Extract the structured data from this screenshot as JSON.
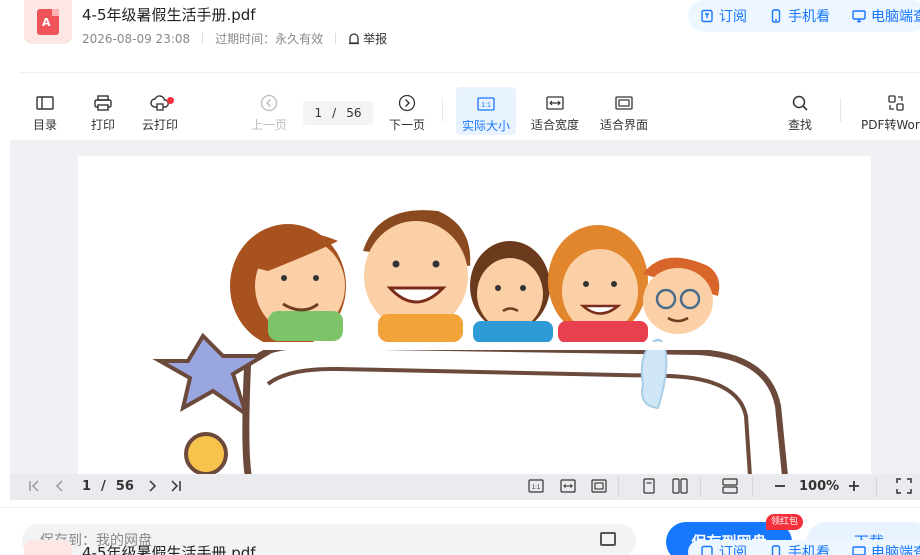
{
  "doc": {
    "title": "4-5年级暑假生活手册.pdf",
    "date": "2026-08-09 23:08",
    "expiry": "过期时间：永久有效",
    "report": "举报",
    "logo_text": "A"
  },
  "header_actions": {
    "subscribe": "订阅",
    "mobile": "手机看",
    "desktop": "电脑端查看"
  },
  "toolbar": {
    "toc": "目录",
    "print": "打印",
    "cloud_print": "云打印",
    "prev_page": "上一页",
    "current_page": "1",
    "page_sep": "/",
    "total_pages": "56",
    "next_page": "下一页",
    "actual_size": "实际大小",
    "fit_width": "适合宽度",
    "fit_page": "适合界面",
    "search": "查找",
    "pdf_to_word": "PDF转Word"
  },
  "bottom_bar": {
    "current_page": "1",
    "page_sep": "/",
    "total_pages": "56",
    "zoom": "100%",
    "icon_actual": "1:1"
  },
  "footer": {
    "save_to": "保存到：我的网盘",
    "save_button": "保存到网盘",
    "badge": "领红包",
    "download": "下载"
  },
  "colors": {
    "accent": "#1677ff",
    "red": "#f5303d",
    "pdf_red": "#f0545a"
  }
}
